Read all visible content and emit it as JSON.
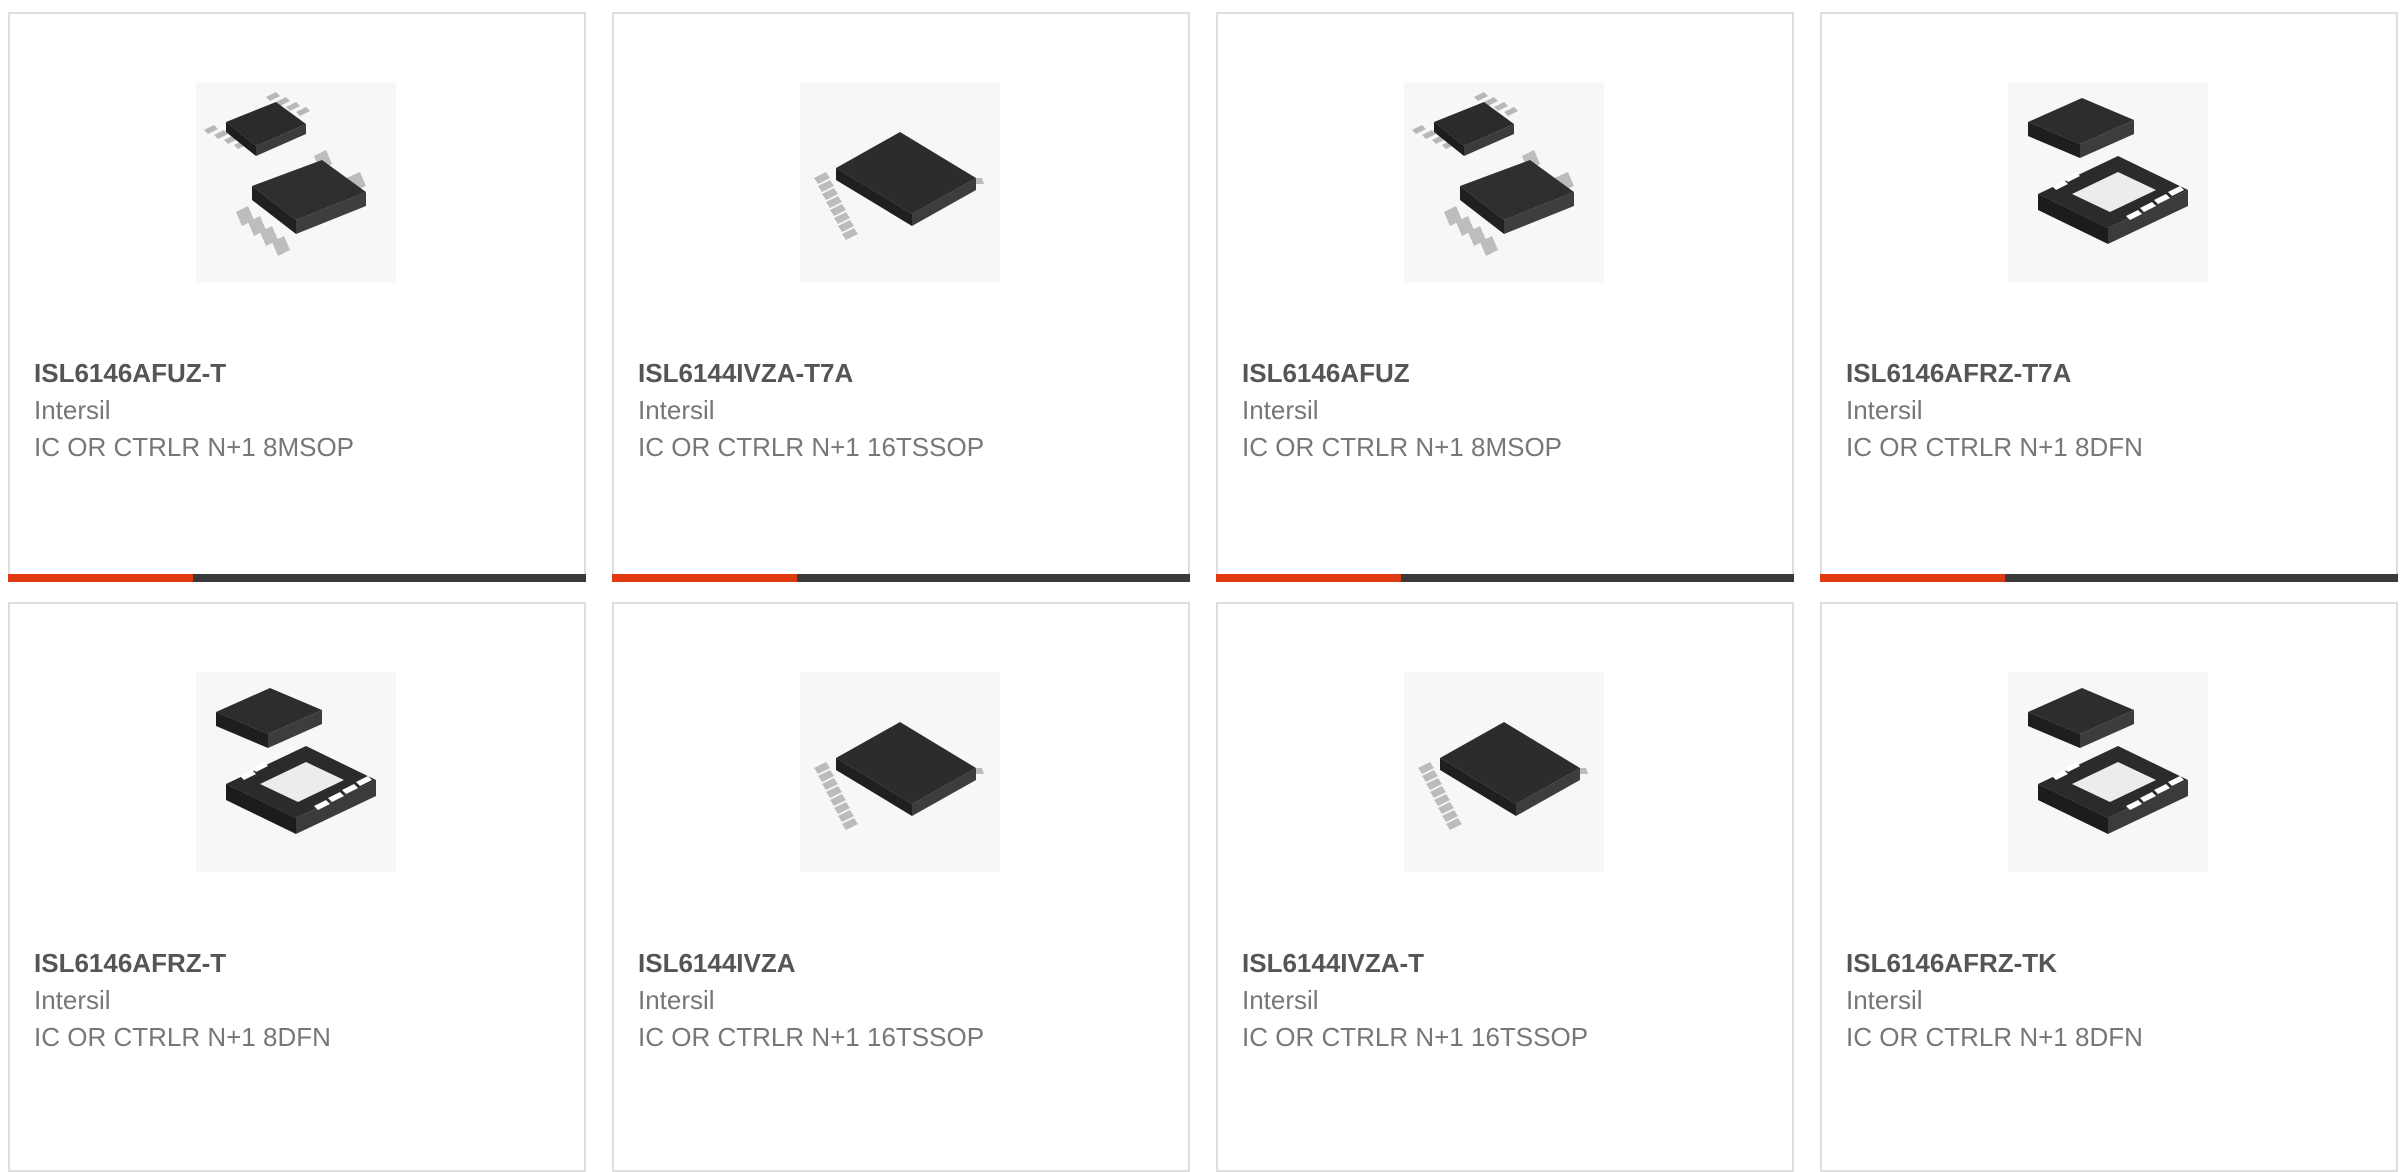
{
  "products": [
    {
      "part_number": "ISL6146AFUZ-T",
      "manufacturer": "Intersil",
      "description": "IC OR CTRLR N+1 8MSOP",
      "image_icon": "msop-8-package-icon",
      "progress": 0.32
    },
    {
      "part_number": "ISL6144IVZA-T7A",
      "manufacturer": "Intersil",
      "description": "IC OR CTRLR N+1 16TSSOP",
      "image_icon": "tssop-16-package-icon",
      "progress": 0.32
    },
    {
      "part_number": "ISL6146AFUZ",
      "manufacturer": "Intersil",
      "description": "IC OR CTRLR N+1 8MSOP",
      "image_icon": "msop-8-package-icon",
      "progress": 0.32
    },
    {
      "part_number": "ISL6146AFRZ-T7A",
      "manufacturer": "Intersil",
      "description": "IC OR CTRLR N+1 8DFN",
      "image_icon": "dfn-8-package-icon",
      "progress": 0.32
    },
    {
      "part_number": "ISL6146AFRZ-T",
      "manufacturer": "Intersil",
      "description": "IC OR CTRLR N+1 8DFN",
      "image_icon": "dfn-8-package-icon",
      "progress": null
    },
    {
      "part_number": "ISL6144IVZA",
      "manufacturer": "Intersil",
      "description": "IC OR CTRLR N+1 16TSSOP",
      "image_icon": "tssop-16-package-icon",
      "progress": null
    },
    {
      "part_number": "ISL6144IVZA-T",
      "manufacturer": "Intersil",
      "description": "IC OR CTRLR N+1 16TSSOP",
      "image_icon": "tssop-16-package-icon",
      "progress": null
    },
    {
      "part_number": "ISL6146AFRZ-TK",
      "manufacturer": "Intersil",
      "description": "IC OR CTRLR N+1 8DFN",
      "image_icon": "dfn-8-package-icon",
      "progress": null
    }
  ],
  "colors": {
    "progress_fill": "#e03a10",
    "progress_track": "#3a3a3a",
    "card_border": "#dedede"
  }
}
